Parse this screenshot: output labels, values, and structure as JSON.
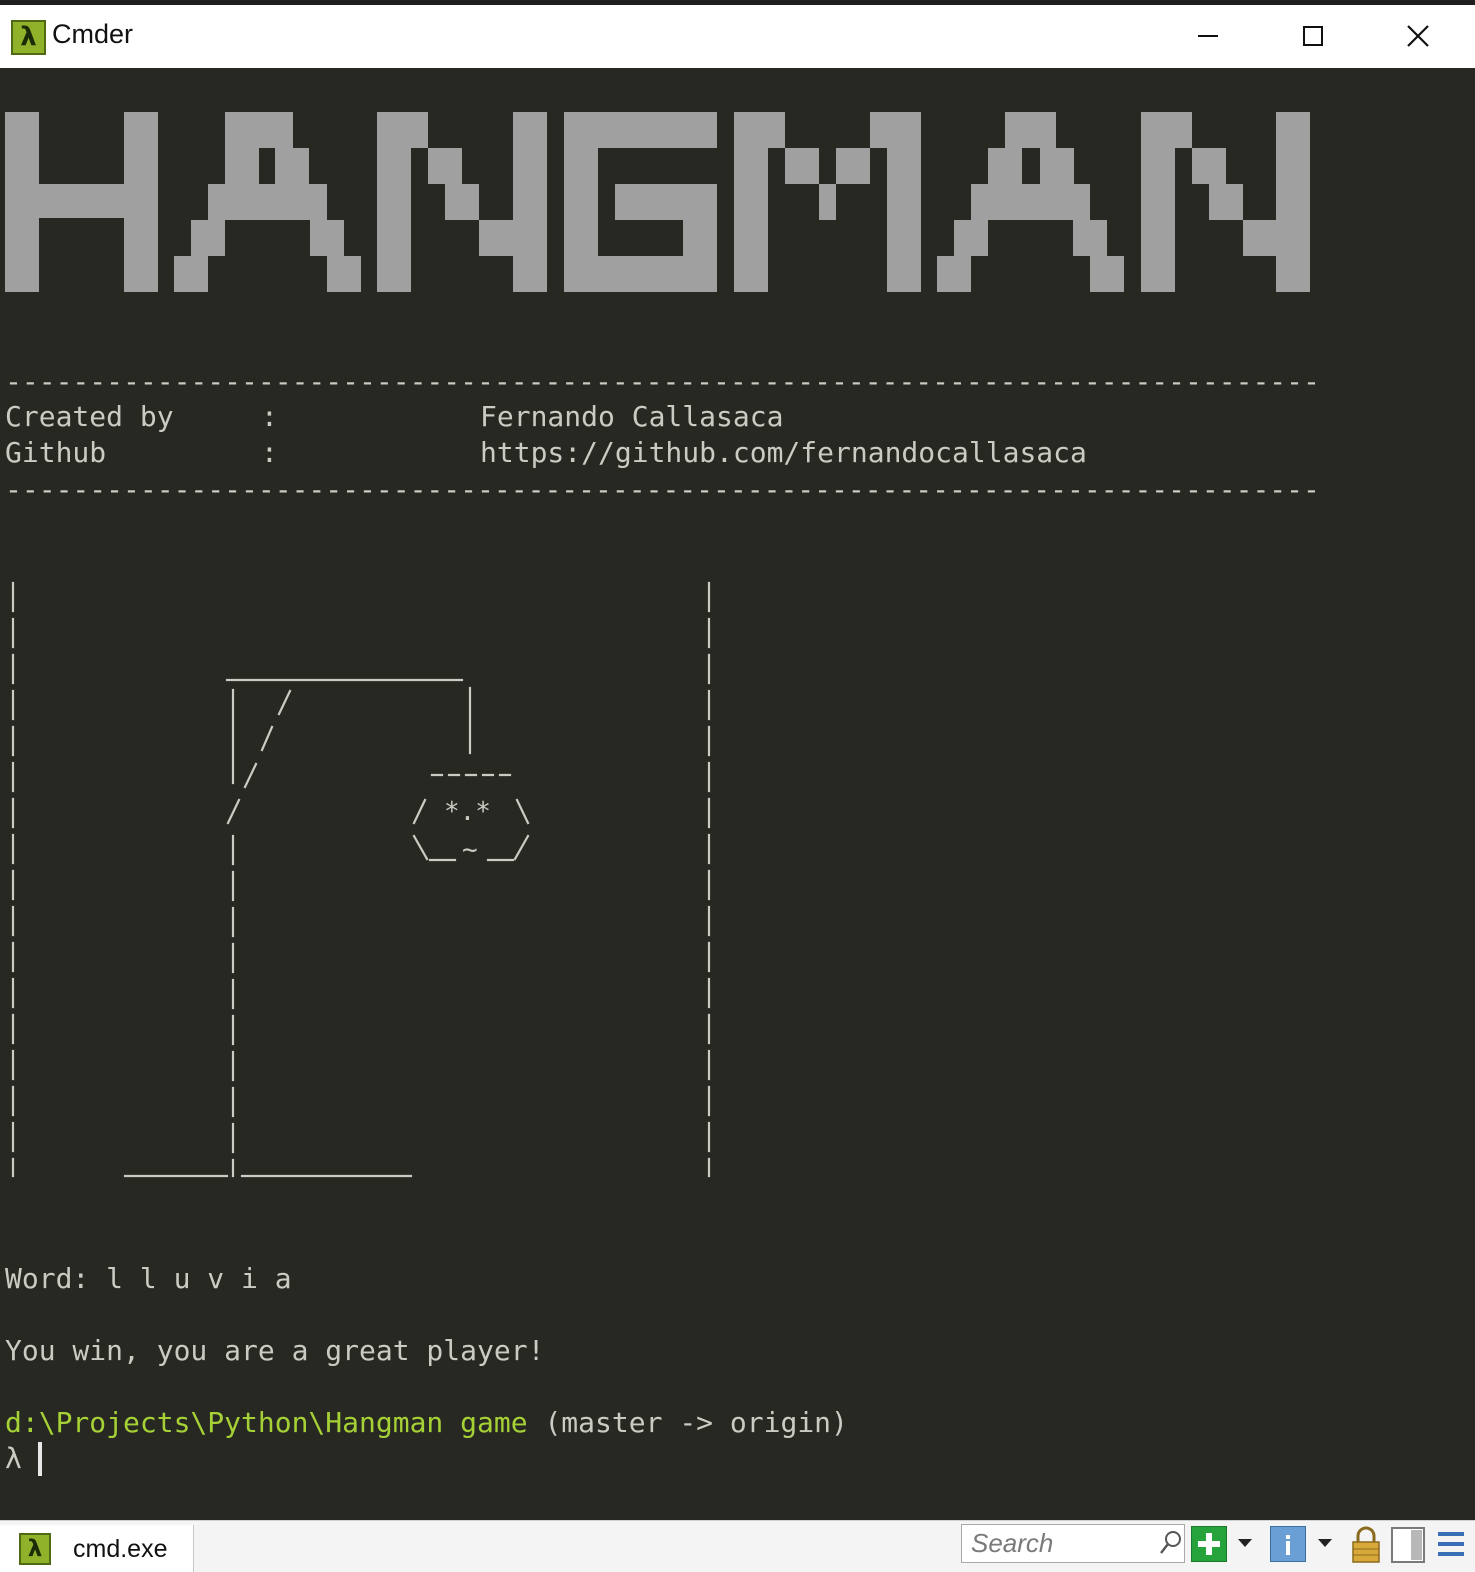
{
  "window": {
    "title": "Cmder",
    "app_icon": "lambda-icon"
  },
  "console": {
    "separator": "------------------------------------------------------------------------------",
    "credits": [
      {
        "label": "Created by",
        "sep": ":",
        "value": "Fernando Callasaca"
      },
      {
        "label": "Github",
        "sep": ":",
        "value": "https://github.com/fernandocallasaca"
      }
    ],
    "word_label": "Word:",
    "word_letters": "l l u v i a",
    "message": "You win, you are a great player!",
    "prompt_path": "d:\\Projects\\Python\\Hangman game",
    "prompt_branch": "(master -> origin)",
    "prompt_symbol": "λ",
    "colors": {
      "background": "#272822",
      "text": "#cbcbc4",
      "path_green": "#a6d136",
      "banner_gray": "#a0a0a0"
    }
  },
  "banner_text": "HANGMAN",
  "statusbar": {
    "tab_label": "cmd.exe",
    "search_placeholder": "Search"
  }
}
